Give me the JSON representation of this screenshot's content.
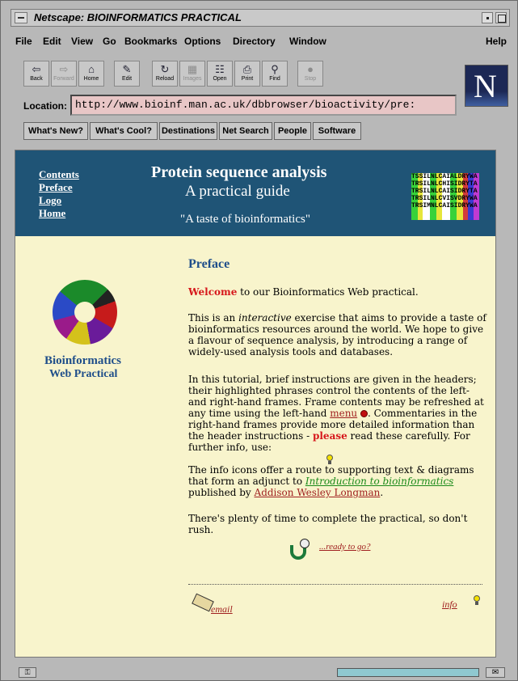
{
  "window": {
    "title": "Netscape: BIOINFORMATICS PRACTICAL"
  },
  "menubar": {
    "items": [
      "File",
      "Edit",
      "View",
      "Go",
      "Bookmarks",
      "Options",
      "Directory",
      "Window"
    ],
    "help": "Help"
  },
  "toolbar": {
    "buttons": [
      {
        "label": "Back",
        "icon": "back-arrow-icon"
      },
      {
        "label": "Forward",
        "icon": "forward-arrow-icon",
        "disabled": true
      },
      {
        "label": "Home",
        "icon": "home-icon"
      },
      {
        "label": "Edit",
        "icon": "pencil-icon"
      },
      {
        "label": "Reload",
        "icon": "reload-icon"
      },
      {
        "label": "Images",
        "icon": "images-icon",
        "disabled": true
      },
      {
        "label": "Open",
        "icon": "open-icon"
      },
      {
        "label": "Print",
        "icon": "print-icon"
      },
      {
        "label": "Find",
        "icon": "binoculars-icon"
      },
      {
        "label": "Stop",
        "icon": "stop-icon",
        "disabled": true
      }
    ]
  },
  "location": {
    "label": "Location:",
    "url": "http://www.bioinf.man.ac.uk/dbbrowser/bioactivity/pre:"
  },
  "directory_buttons": [
    "What's New?",
    "What's Cool?",
    "Destinations",
    "Net Search",
    "People",
    "Software"
  ],
  "banner": {
    "links": [
      "Contents",
      "Preface",
      "Logo",
      "Home"
    ],
    "title": "Protein sequence analysis",
    "subtitle": "A practical guide",
    "tagline": "\"A taste of bioinformatics\"",
    "sequence_rows": [
      "TSSILNLCAIALDRYWA",
      "TRSILNLCHISIDRYTA",
      "TRSILNLCAISIDRYTA",
      "TRSILNLCVISVDRYWA",
      "TRSIMNLCAISIDRYWA"
    ]
  },
  "sidebar": {
    "label_line1": "Bioinformatics",
    "label_line2": "Web Practical"
  },
  "main": {
    "heading": "Preface",
    "p1_red": "Welcome",
    "p1_rest": " to our Bioinformatics Web practical.",
    "p2_a": "This is an ",
    "p2_em": "interactive",
    "p2_b": " exercise that aims to provide a taste of bioinformatics resources around the world. We hope to give a flavour of sequence analysis, by introducing a range of widely-used analysis tools and databases.",
    "p3_a": "In this tutorial, brief instructions are given in the headers; their highlighted phrases control the contents of the left- and right-hand frames. Frame contents may be refreshed at any time using the left-hand ",
    "p3_link": "menu",
    "p3_b": ". Commentaries in the right-hand frames provide more detailed information than the header instructions - ",
    "p3_red": "please",
    "p3_c": " read these carefully. For further info, use:",
    "p4_a": "The info icons offer a route to supporting text & diagrams that form an adjunct to ",
    "p4_book": "Introduction to bioinformatics",
    "p4_b": " published by ",
    "p4_link": "Addison Wesley Longman",
    "p4_c": ".",
    "p5": "There's plenty of time to complete the practical, so don't rush.",
    "ready": "...ready to go?",
    "email": "email",
    "info": "info"
  },
  "colors": {
    "banner_bg": "#1f5476",
    "page_bg": "#f8f4cc",
    "heading": "#1f4e8a",
    "accent_red": "#d6171b",
    "link": "#a02020"
  }
}
